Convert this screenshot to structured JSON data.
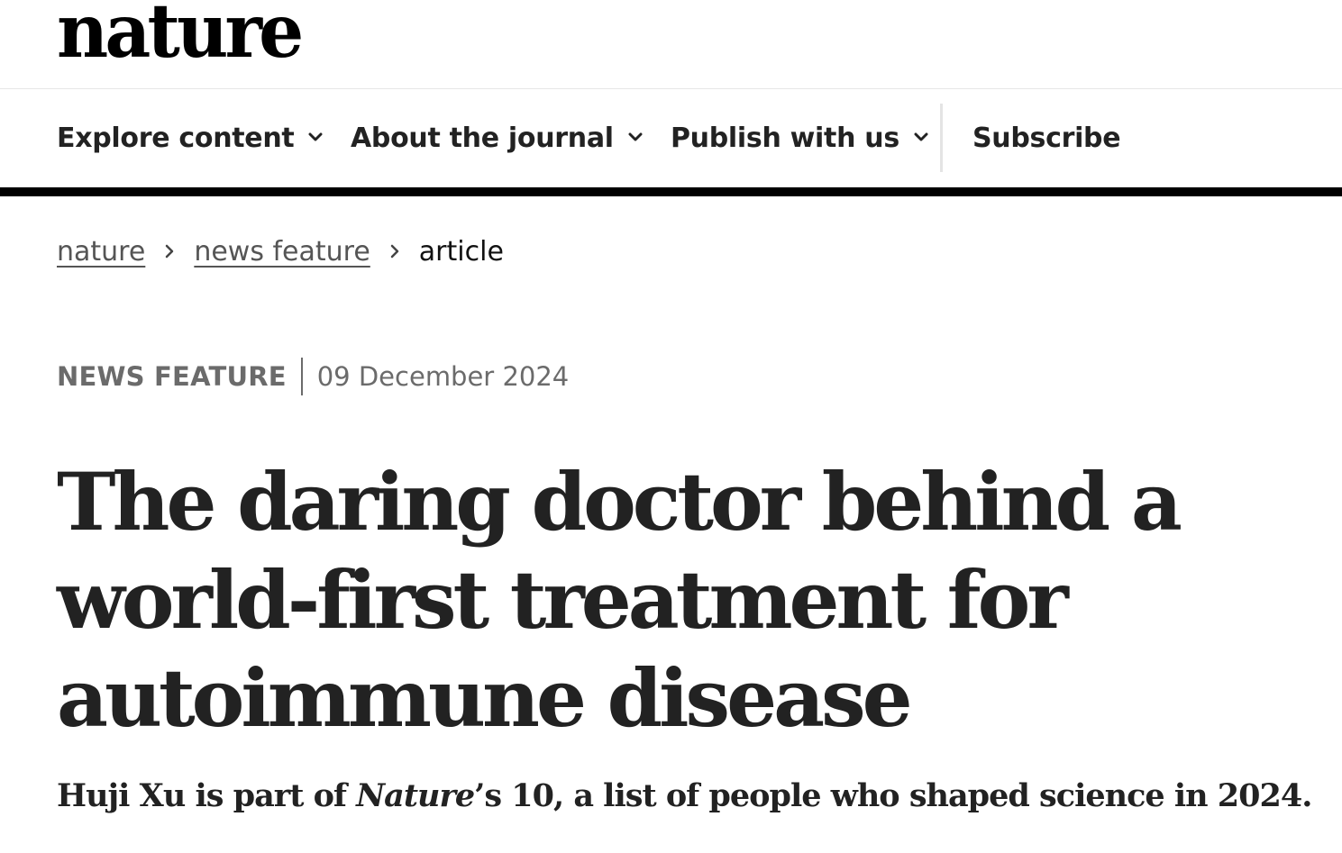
{
  "site": {
    "logo": "nature"
  },
  "nav": {
    "items": [
      {
        "label": "Explore content"
      },
      {
        "label": "About the journal"
      },
      {
        "label": "Publish with us"
      }
    ],
    "subscribe": "Subscribe"
  },
  "breadcrumb": {
    "items": [
      {
        "label": "nature"
      },
      {
        "label": "news feature"
      }
    ],
    "current": "article"
  },
  "article": {
    "type": "NEWS FEATURE",
    "date": "09 December 2024",
    "title": "The daring doctor behind a world-first treatment for autoimmune disease",
    "standfirst": {
      "prefix": "Huji Xu is part of ",
      "emphasis": "Nature",
      "suffix": "’s 10, a list of people who shaped science in 2024."
    }
  },
  "icons": {
    "nav_dropdown": "chevron-down-icon",
    "breadcrumb_separator": "chevron-right-icon"
  },
  "colors": {
    "text": "#222222",
    "muted": "#6b6b6b",
    "rule": "#000000"
  }
}
